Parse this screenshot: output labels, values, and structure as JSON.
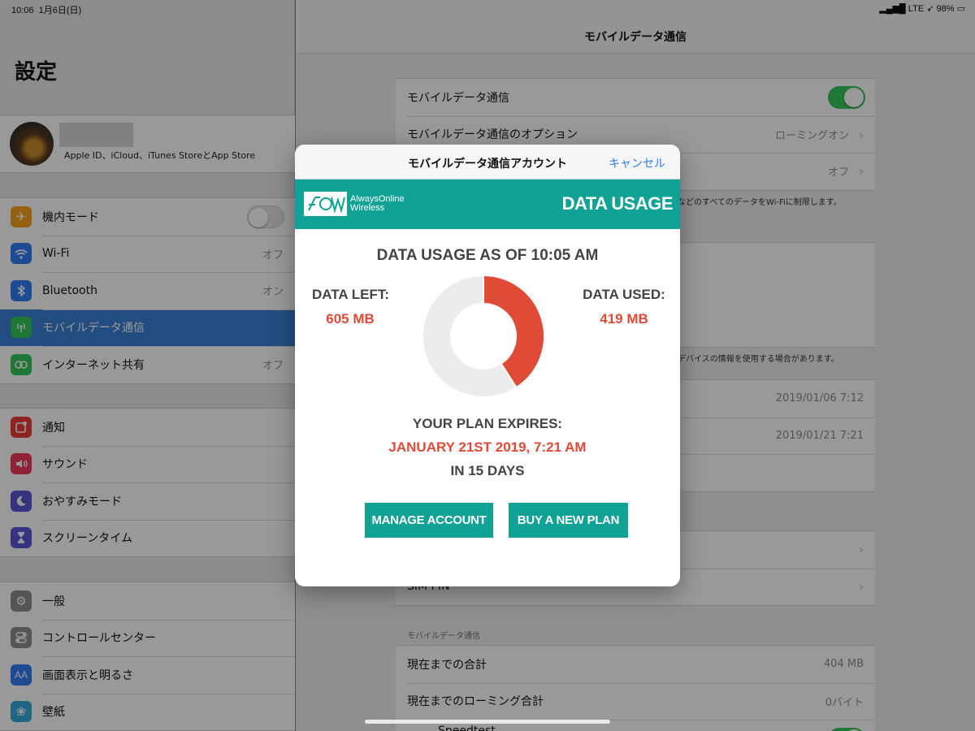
{
  "status_bar": {
    "time": "10:06",
    "date": "1月6日(日)",
    "network": "LTE",
    "battery": "98%"
  },
  "sidebar": {
    "title": "設定",
    "profile": {
      "subtitle": "Apple ID、iCloud、iTunes StoreとApp Store"
    },
    "groups": [
      [
        {
          "label": "機内モード",
          "icon": "airplane-icon",
          "color": "#f7a21b",
          "value": ""
        },
        {
          "label": "Wi-Fi",
          "icon": "wifi-icon",
          "color": "#2f7df6",
          "value": "オフ"
        },
        {
          "label": "Bluetooth",
          "icon": "bluetooth-icon",
          "color": "#2f7df6",
          "value": "オン"
        },
        {
          "label": "モバイルデータ通信",
          "icon": "antenna-icon",
          "color": "#34c759",
          "value": "",
          "selected": true
        },
        {
          "label": "インターネット共有",
          "icon": "link-icon",
          "color": "#34c759",
          "value": "オフ"
        }
      ],
      [
        {
          "label": "通知",
          "icon": "notification-icon",
          "color": "#ef3b39",
          "value": ""
        },
        {
          "label": "サウンド",
          "icon": "speaker-icon",
          "color": "#ef3a5d",
          "value": ""
        },
        {
          "label": "おやすみモード",
          "icon": "moon-icon",
          "color": "#5b56d6",
          "value": ""
        },
        {
          "label": "スクリーンタイム",
          "icon": "hourglass-icon",
          "color": "#5b56d6",
          "value": ""
        }
      ],
      [
        {
          "label": "一般",
          "icon": "gear-icon",
          "color": "#8e8e93",
          "value": ""
        },
        {
          "label": "コントロールセンター",
          "icon": "switches-icon",
          "color": "#8e8e93",
          "value": ""
        },
        {
          "label": "画面表示と明るさ",
          "icon": "text-size-icon",
          "color": "#2f7df6",
          "value": ""
        },
        {
          "label": "壁紙",
          "icon": "flower-icon",
          "color": "#35aadc",
          "value": ""
        }
      ]
    ]
  },
  "main": {
    "title": "モバイルデータ通信",
    "rows": {
      "cellular": "モバイルデータ通信",
      "options": "モバイルデータ通信のオプション",
      "options_value": "ローミングオン",
      "hidden_value": "オフ",
      "note1": "知などのすべてのデータをWi-Fiに制限します。",
      "note2": "びデバイスの情報を使用する場合があります。",
      "date1": "2019/01/06 7:12",
      "date2": "2019/01/21 7:21",
      "sim_pin": "SIM PIN"
    },
    "usage_header": "モバイルデータ通信",
    "usage_rows": [
      {
        "label": "現在までの合計",
        "value": "404 MB"
      },
      {
        "label": "現在までのローミング合計",
        "value": "0バイト"
      }
    ],
    "partial_app": "Speedtest"
  },
  "modal": {
    "title": "モバイルデータ通信アカウント",
    "cancel": "キャンセル",
    "brand_line1": "AlwaysOnline",
    "brand_line2": "Wireless",
    "banner_title": "DATA USAGE",
    "usage_heading": "DATA USAGE AS OF 10:05 AM",
    "left_label": "DATA LEFT:",
    "left_value": "605 MB",
    "used_label": "DATA USED:",
    "used_value": "419 MB",
    "expires_label": "YOUR PLAN EXPIRES:",
    "expires_date": "JANUARY 21ST 2019, 7:21 AM",
    "expires_days": "IN 15 DAYS",
    "manage_button": "MANAGE ACCOUNT",
    "buy_button": "BUY A NEW PLAN",
    "colors": {
      "accent": "#10a295",
      "used": "#e04b37",
      "left": "#ececec"
    }
  },
  "chart_data": {
    "type": "pie",
    "categories": [
      "DATA USED:",
      "DATA LEFT:"
    ],
    "values": [
      419,
      605
    ]
  }
}
